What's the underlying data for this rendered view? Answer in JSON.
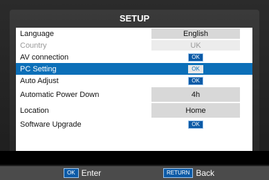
{
  "menu": {
    "title": "SETUP",
    "rows": [
      {
        "label": "Language",
        "value": "English"
      },
      {
        "label": "Country",
        "value": "UK"
      },
      {
        "label": "AV connection",
        "value": "OK"
      },
      {
        "label": "PC Setting",
        "value": "OK"
      },
      {
        "label": "Auto Adjust",
        "value": "OK"
      },
      {
        "label": "Automatic Power Down",
        "value": "4h"
      },
      {
        "label": "Location",
        "value": "Home"
      },
      {
        "label": "Software Upgrade",
        "value": "OK"
      }
    ]
  },
  "footer": {
    "enter_key": "OK",
    "enter_label": "Enter",
    "back_key": "RETURN",
    "back_label": "Back"
  },
  "colors": {
    "selection": "#0c6fb8",
    "key_bg": "#0c5aa6"
  }
}
